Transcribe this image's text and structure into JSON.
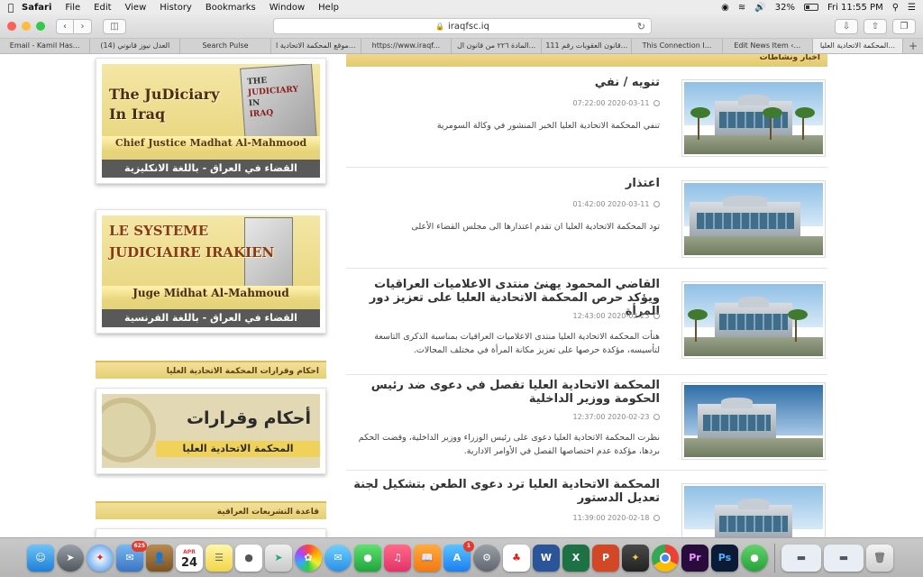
{
  "menubar": {
    "app": "Safari",
    "items": [
      "File",
      "Edit",
      "View",
      "History",
      "Bookmarks",
      "Window",
      "Help"
    ],
    "battery": "32%",
    "clock": "Fri 11:55 PM"
  },
  "toolbar": {
    "url": "iraqfsc.iq"
  },
  "tabs": [
    "Email - Kamil Has...",
    "(14) العدل نيوز قانوني",
    "Search Pulse",
    "موقع المحكمة الاتحادية ا...",
    "https://www.iraqf...",
    "المادة ٢٢٦ من قانون ال...",
    "قانون العقوبات رقم 111...",
    "This Connection I...",
    "Edit News Item ‹...",
    "المحكمة الاتحادية العليا..."
  ],
  "sidebar": {
    "banner1": {
      "title_line1": "The JuDiciary",
      "title_line2": "In Iraq",
      "subtitle": "Chief Justice Madhat Al-Mahmood",
      "arabic": "القضاء في العراق - باللغة الانكليزية",
      "book_line1": "THE",
      "book_line2": "JUDICIARY",
      "book_line3": "IN",
      "book_line4": "IRAQ"
    },
    "banner2": {
      "title_line1": "LE SYSTEME",
      "title_line2": "JUDICIAIRE IRAKIEN",
      "subtitle": "Juge Midhat Al-Mahmoud",
      "arabic": "القضاء في العراق - باللغة الفرنسية"
    },
    "section1": "احكام وقرارات المحكمة الاتحادية العليا",
    "rulings_banner": {
      "title": "أحكام وقرارات",
      "subtitle": "المحكمة الاتحادية العليا"
    },
    "section2": "قاعدة التشريعات العراقية"
  },
  "news": {
    "header": "اخبار ونشاطات",
    "items": [
      {
        "title": "تنويه / نفي",
        "date": "07:22:00 2020-03-11",
        "desc": "تنفي المحكمة الاتحادية العليا الخبر المنشور في وكالة السومرية"
      },
      {
        "title": "اعتذار",
        "date": "01:42:00 2020-03-11",
        "desc": "تود المحكمة الاتحادية العليا ان تقدم اعتذارها الى مجلس القضاء الأعلى"
      },
      {
        "title": "القاضي المحمود يهنئ منتدى الاعلاميات العراقيات ويؤكد حرص المحكمة الاتحادية العليا على تعزيز دور المرأة",
        "date": "12:43:00 2020-02-23",
        "desc": "هنأت المحكمة الاتحادية العليا منتدى الاعلاميات العراقيات بمناسبة الذكرى التاسعة لتأسيسه، مؤكدة حرصها على تعزيز مكانة المرأة في مختلف المجالات."
      },
      {
        "title": "المحكمة الاتحادية العليا تفصل في دعوى ضد رئيس الحكومة ووزير الداخلية",
        "date": "12:37:00 2020-02-23",
        "desc": "نظرت المحكمة الاتحادية العليا دعوى على رئيس الوزراء ووزير الداخلية، وقضت الحكم بردها، مؤكدة عدم اختصاصها الفصل في الأوامر الادارية."
      },
      {
        "title": "المحكمة الاتحادية العليا ترد دعوى الطعن بتشكيل لجنة تعديل الدستور",
        "date": "11:39:00 2020-02-18",
        "desc": ""
      }
    ]
  },
  "dock": {
    "mail_badge": "625",
    "appstore_badge": "1",
    "calendar_month": "APR",
    "calendar_day": "24"
  }
}
